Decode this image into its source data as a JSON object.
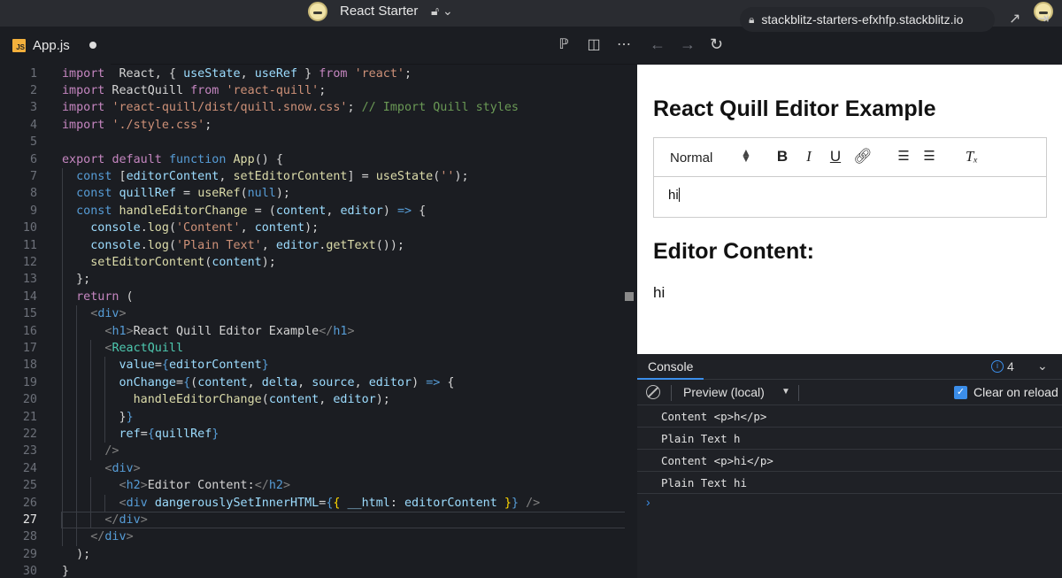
{
  "window": {
    "title": "React Starter"
  },
  "editor": {
    "tab": {
      "filename": "App.js",
      "badge": "JS"
    },
    "active_line": 27,
    "lines": [
      [
        [
          "k",
          "import"
        ],
        [
          "",
          "  React, { "
        ],
        [
          "v",
          "useState"
        ],
        [
          "",
          ", "
        ],
        [
          "v",
          "useRef"
        ],
        [
          "",
          " } "
        ],
        [
          "k",
          "from"
        ],
        [
          "",
          " "
        ],
        [
          "s",
          "'react'"
        ],
        [
          "",
          ";"
        ]
      ],
      [
        [
          "k",
          "import"
        ],
        [
          "",
          " ReactQuill "
        ],
        [
          "k",
          "from"
        ],
        [
          "",
          " "
        ],
        [
          "s",
          "'react-quill'"
        ],
        [
          "",
          ";"
        ]
      ],
      [
        [
          "k",
          "import"
        ],
        [
          "",
          " "
        ],
        [
          "s",
          "'react-quill/dist/quill.snow.css'"
        ],
        [
          "",
          "; "
        ],
        [
          "c",
          "// Import Quill styles"
        ]
      ],
      [
        [
          "k",
          "import"
        ],
        [
          "",
          " "
        ],
        [
          "s",
          "'./style.css'"
        ],
        [
          "",
          ";"
        ]
      ],
      [],
      [
        [
          "k",
          "export"
        ],
        [
          "",
          " "
        ],
        [
          "k",
          "default"
        ],
        [
          "",
          " "
        ],
        [
          "b",
          "function"
        ],
        [
          "",
          " "
        ],
        [
          "f",
          "App"
        ],
        [
          "",
          "() {"
        ]
      ],
      [
        [
          "",
          "  "
        ],
        [
          "b",
          "const"
        ],
        [
          "",
          " ["
        ],
        [
          "v",
          "editorContent"
        ],
        [
          "",
          ", "
        ],
        [
          "f",
          "setEditorContent"
        ],
        [
          "",
          "] = "
        ],
        [
          "f",
          "useState"
        ],
        [
          "",
          "("
        ],
        [
          "s",
          "''"
        ],
        [
          "",
          ");"
        ]
      ],
      [
        [
          "",
          "  "
        ],
        [
          "b",
          "const"
        ],
        [
          "",
          " "
        ],
        [
          "v",
          "quillRef"
        ],
        [
          "",
          " = "
        ],
        [
          "f",
          "useRef"
        ],
        [
          "",
          "("
        ],
        [
          "b",
          "null"
        ],
        [
          "",
          ");"
        ]
      ],
      [
        [
          "",
          "  "
        ],
        [
          "b",
          "const"
        ],
        [
          "",
          " "
        ],
        [
          "f",
          "handleEditorChange"
        ],
        [
          "",
          " = ("
        ],
        [
          "v",
          "content"
        ],
        [
          "",
          ", "
        ],
        [
          "v",
          "editor"
        ],
        [
          "",
          ") "
        ],
        [
          "b",
          "=>"
        ],
        [
          "",
          " {"
        ]
      ],
      [
        [
          "",
          "    "
        ],
        [
          "v",
          "console"
        ],
        [
          "",
          "."
        ],
        [
          "f",
          "log"
        ],
        [
          "",
          "("
        ],
        [
          "s",
          "'Content'"
        ],
        [
          "",
          ", "
        ],
        [
          "v",
          "content"
        ],
        [
          "",
          ");"
        ]
      ],
      [
        [
          "",
          "    "
        ],
        [
          "v",
          "console"
        ],
        [
          "",
          "."
        ],
        [
          "f",
          "log"
        ],
        [
          "",
          "("
        ],
        [
          "s",
          "'Plain Text'"
        ],
        [
          "",
          ", "
        ],
        [
          "v",
          "editor"
        ],
        [
          "",
          "."
        ],
        [
          "f",
          "getText"
        ],
        [
          "",
          "());"
        ]
      ],
      [
        [
          "",
          "    "
        ],
        [
          "f",
          "setEditorContent"
        ],
        [
          "",
          "("
        ],
        [
          "v",
          "content"
        ],
        [
          "",
          ");"
        ]
      ],
      [
        [
          "",
          "  };"
        ]
      ],
      [
        [
          "",
          "  "
        ],
        [
          "k",
          "return"
        ],
        [
          "",
          " ("
        ]
      ],
      [
        [
          "",
          "    "
        ],
        [
          "p",
          "<"
        ],
        [
          "tg",
          "div"
        ],
        [
          "p",
          ">"
        ]
      ],
      [
        [
          "",
          "      "
        ],
        [
          "p",
          "<"
        ],
        [
          "tg",
          "h1"
        ],
        [
          "p",
          ">"
        ],
        [
          "",
          "React Quill Editor Example"
        ],
        [
          "p",
          "</"
        ],
        [
          "tg",
          "h1"
        ],
        [
          "p",
          ">"
        ]
      ],
      [
        [
          "",
          "      "
        ],
        [
          "p",
          "<"
        ],
        [
          "t",
          "ReactQuill"
        ]
      ],
      [
        [
          "",
          "        "
        ],
        [
          "v",
          "value"
        ],
        [
          "",
          "="
        ],
        [
          "b",
          "{"
        ],
        [
          "v",
          "editorContent"
        ],
        [
          "b",
          "}"
        ]
      ],
      [
        [
          "",
          "        "
        ],
        [
          "v",
          "onChange"
        ],
        [
          "",
          "="
        ],
        [
          "b",
          "{"
        ],
        [
          "",
          "("
        ],
        [
          "v",
          "content"
        ],
        [
          "",
          ", "
        ],
        [
          "v",
          "delta"
        ],
        [
          "",
          ", "
        ],
        [
          "v",
          "source"
        ],
        [
          "",
          ", "
        ],
        [
          "v",
          "editor"
        ],
        [
          "",
          ") "
        ],
        [
          "b",
          "=>"
        ],
        [
          "",
          " {"
        ]
      ],
      [
        [
          "",
          "          "
        ],
        [
          "f",
          "handleEditorChange"
        ],
        [
          "",
          "("
        ],
        [
          "v",
          "content"
        ],
        [
          "",
          ", "
        ],
        [
          "v",
          "editor"
        ],
        [
          "",
          ");"
        ]
      ],
      [
        [
          "",
          "        }"
        ],
        [
          "b",
          "}"
        ]
      ],
      [
        [
          "",
          "        "
        ],
        [
          "v",
          "ref"
        ],
        [
          "",
          "="
        ],
        [
          "b",
          "{"
        ],
        [
          "v",
          "quillRef"
        ],
        [
          "b",
          "}"
        ]
      ],
      [
        [
          "",
          "      "
        ],
        [
          "p",
          "/>"
        ]
      ],
      [
        [
          "",
          "      "
        ],
        [
          "p",
          "<"
        ],
        [
          "tg",
          "div"
        ],
        [
          "p",
          ">"
        ]
      ],
      [
        [
          "",
          "        "
        ],
        [
          "p",
          "<"
        ],
        [
          "tg",
          "h2"
        ],
        [
          "p",
          ">"
        ],
        [
          "",
          "Editor Content:"
        ],
        [
          "p",
          "</"
        ],
        [
          "tg",
          "h2"
        ],
        [
          "p",
          ">"
        ]
      ],
      [
        [
          "",
          "        "
        ],
        [
          "p",
          "<"
        ],
        [
          "tg",
          "div"
        ],
        [
          "",
          " "
        ],
        [
          "v",
          "dangerouslySetInnerHTML"
        ],
        [
          "",
          "="
        ],
        [
          "b",
          "{"
        ],
        [
          "y",
          "{"
        ],
        [
          "",
          " "
        ],
        [
          "v",
          "__html"
        ],
        [
          "",
          ": "
        ],
        [
          "v",
          "editorContent"
        ],
        [
          "",
          " "
        ],
        [
          "y",
          "}"
        ],
        [
          "b",
          "}"
        ],
        [
          "",
          " "
        ],
        [
          "p",
          "/>"
        ]
      ],
      [
        [
          "",
          "      "
        ],
        [
          "p",
          "</"
        ],
        [
          "tg",
          "div"
        ],
        [
          "p",
          ">"
        ]
      ],
      [
        [
          "",
          "    "
        ],
        [
          "p",
          "</"
        ],
        [
          "tg",
          "div"
        ],
        [
          "p",
          ">"
        ]
      ],
      [
        [
          "",
          "  );"
        ]
      ],
      [
        [
          "",
          "}"
        ]
      ]
    ]
  },
  "browser": {
    "url": "stackblitz-starters-efxhfp.stackblitz.io"
  },
  "preview": {
    "heading": "React Quill Editor Example",
    "toolbar": {
      "format_select": "Normal",
      "bold": "B",
      "italic": "I",
      "underline": "U"
    },
    "editor_text": "hi",
    "subheading": "Editor Content:",
    "output": "hi"
  },
  "console": {
    "tab_label": "Console",
    "message_count": "4",
    "context": "Preview (local)",
    "clear_on_reload_label": "Clear on reload",
    "clear_on_reload": true,
    "logs": [
      "Content <p>h</p>",
      "Plain Text h",
      "Content <p>hi</p>",
      "Plain Text hi"
    ]
  },
  "colors": {
    "accent": "#3b8eea",
    "editor_bg": "#1b1d22",
    "keyword": "#c586c0",
    "string": "#ce9178",
    "comment": "#6a9955"
  }
}
